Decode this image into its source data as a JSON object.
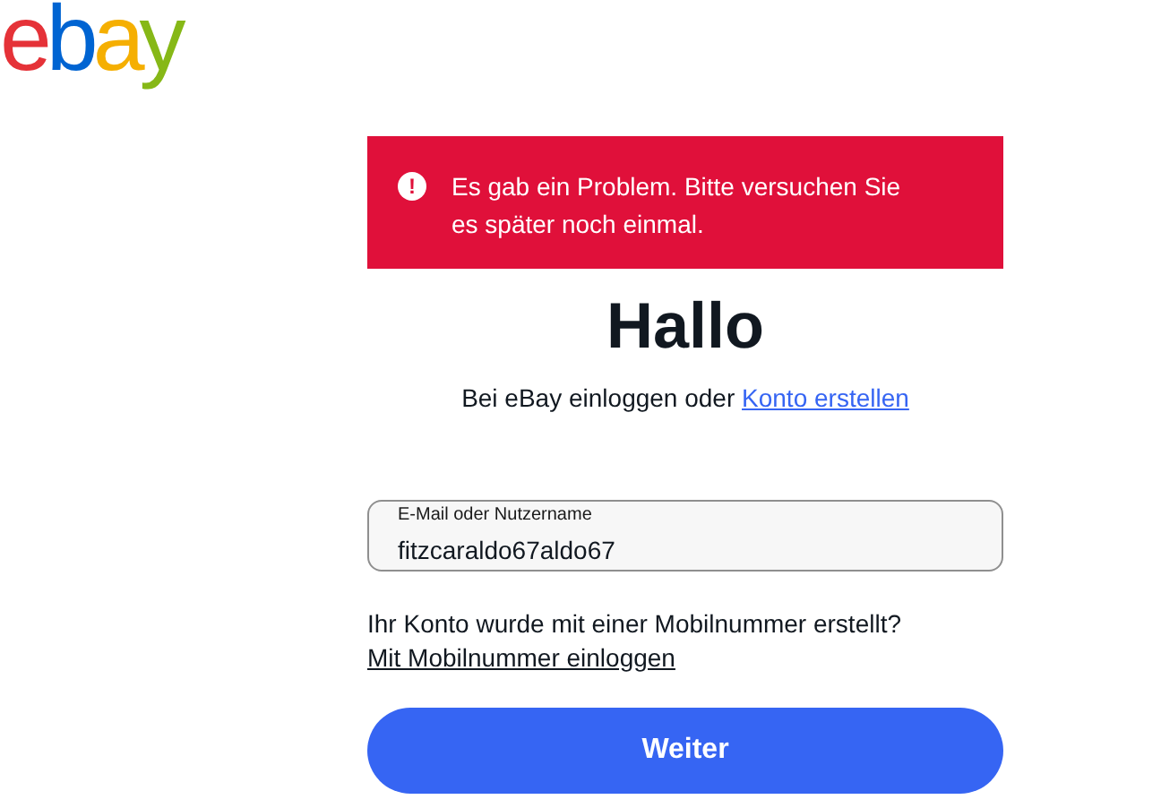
{
  "logo": "ebay",
  "alert": {
    "icon": "!",
    "message": "Es gab ein Problem. Bitte versuchen Sie es später noch einmal."
  },
  "heading": "Hallo",
  "subtitle": {
    "text": "Bei eBay einloggen oder",
    "link": "Konto erstellen"
  },
  "login_field": {
    "label": "E-Mail oder Nutzername",
    "value": "fitzcaraldo67aldo67"
  },
  "mobile_prompt": {
    "question": "Ihr Konto wurde mit einer Mobilnummer erstellt?",
    "link": "Mit Mobilnummer einloggen"
  },
  "continue_button": "Weiter"
}
